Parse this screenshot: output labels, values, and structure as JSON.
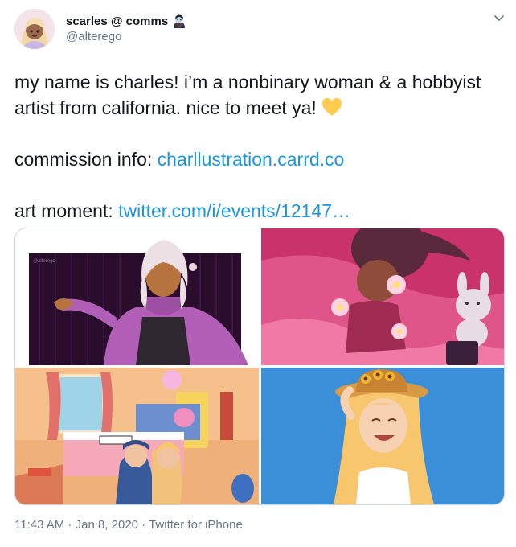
{
  "tweet": {
    "display_name": "scarles @ comms",
    "handle": "@alterego",
    "line1": "my name is charles! i’m a nonbinary woman & a hobbyist artist from california. nice to meet ya!",
    "line2_label": "commission info: ",
    "line2_link": "charllustration.carrd.co",
    "line3_label": "art moment: ",
    "line3_link": "twitter.com/i/events/12147…",
    "watermark": "@alterego",
    "time": "11:43 AM",
    "separator": " · ",
    "date": "Jan 8, 2020",
    "source": "Twitter for iPhone"
  },
  "icons": {
    "name_emoji": "woman-vampire-emoji",
    "text_emoji": "yellow-heart-emoji",
    "menu": "chevron-down-icon"
  },
  "colors": {
    "text": "#14171a",
    "secondary": "#657786",
    "link": "#1b95e0",
    "border": "#ccd6dd"
  }
}
